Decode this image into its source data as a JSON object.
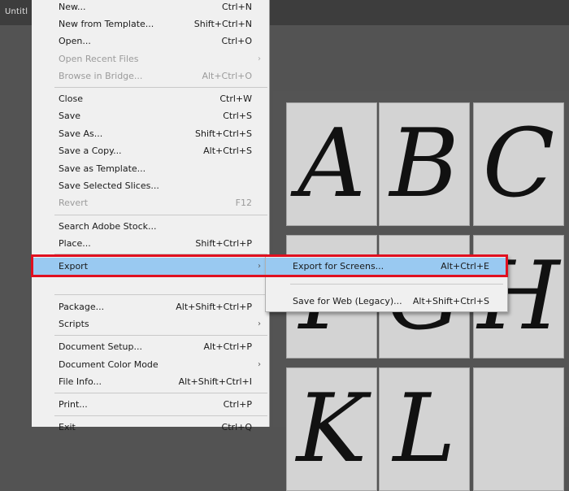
{
  "app": {
    "title_overlay": "Untitl"
  },
  "menu": {
    "items": [
      {
        "label": "New...",
        "shortcut": "Ctrl+N"
      },
      {
        "label": "New from Template...",
        "shortcut": "Shift+Ctrl+N"
      },
      {
        "label": "Open...",
        "shortcut": "Ctrl+O"
      },
      {
        "label": "Open Recent Files",
        "shortcut": ""
      },
      {
        "label": "Browse in Bridge...",
        "shortcut": "Alt+Ctrl+O"
      },
      {
        "label": "Close",
        "shortcut": "Ctrl+W"
      },
      {
        "label": "Save",
        "shortcut": "Ctrl+S"
      },
      {
        "label": "Save As...",
        "shortcut": "Shift+Ctrl+S"
      },
      {
        "label": "Save a Copy...",
        "shortcut": "Alt+Ctrl+S"
      },
      {
        "label": "Save as Template...",
        "shortcut": ""
      },
      {
        "label": "Save Selected Slices...",
        "shortcut": ""
      },
      {
        "label": "Revert",
        "shortcut": "F12"
      },
      {
        "label": "Search Adobe Stock...",
        "shortcut": ""
      },
      {
        "label": "Place...",
        "shortcut": "Shift+Ctrl+P"
      },
      {
        "label": "Export",
        "shortcut": ""
      },
      {
        "label": "Package...",
        "shortcut": "Alt+Shift+Ctrl+P"
      },
      {
        "label": "Scripts",
        "shortcut": ""
      },
      {
        "label": "Document Setup...",
        "shortcut": "Alt+Ctrl+P"
      },
      {
        "label": "Document Color Mode",
        "shortcut": ""
      },
      {
        "label": "File Info...",
        "shortcut": "Alt+Shift+Ctrl+I"
      },
      {
        "label": "Print...",
        "shortcut": "Ctrl+P"
      },
      {
        "label": "Exit",
        "shortcut": "Ctrl+Q"
      }
    ]
  },
  "submenu": {
    "items": [
      {
        "label": "Export for Screens...",
        "shortcut": "Alt+Ctrl+E"
      },
      {
        "label": "Save for Web (Legacy)...",
        "shortcut": "Alt+Shift+Ctrl+S"
      }
    ]
  },
  "canvas": {
    "letters": [
      "A",
      "B",
      "C",
      "F",
      "G",
      "H",
      "K",
      "L",
      ""
    ]
  },
  "colors": {
    "highlight": "#99c9f1",
    "annotation_box": "#e01020",
    "menu_bg": "#f0f0f0"
  }
}
